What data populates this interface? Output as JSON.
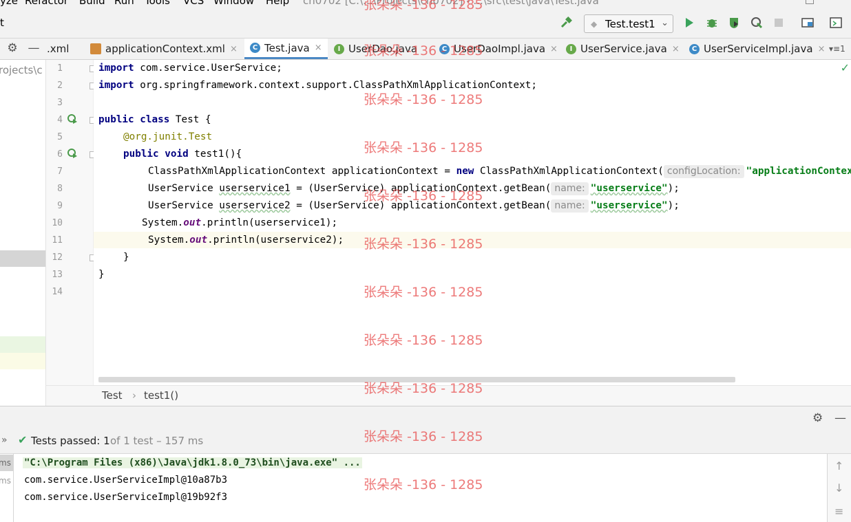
{
  "menu": {
    "items": [
      "yze",
      "Refactor",
      "Build",
      "Run",
      "Tools",
      "VCS",
      "Window",
      "Help"
    ],
    "window_title": "ch0702 [C:\\...\\Projects\\ch0702] - ...\\src\\test\\java\\Test.java"
  },
  "toolbar": {
    "crumb": "t",
    "run_config": "Test.test1",
    "icons": [
      "hammer-icon",
      "run-icon",
      "debug-icon",
      "coverage-icon",
      "profile-icon",
      "stop-icon",
      "project-structure-icon",
      "terminal-icon"
    ]
  },
  "tabs": [
    {
      "label": ".xml",
      "type": "xml"
    },
    {
      "label": "applicationContext.xml",
      "type": "xml"
    },
    {
      "label": "Test.java",
      "type": "class",
      "active": true
    },
    {
      "label": "UserDao.java",
      "type": "interface"
    },
    {
      "label": "UserDaoImpl.java",
      "type": "class"
    },
    {
      "label": "UserService.java",
      "type": "interface"
    },
    {
      "label": "UserServiceImpl.java",
      "type": "class"
    }
  ],
  "tab_overflow": "▾≡1",
  "project_panel": {
    "path_fragment": "rojects\\c"
  },
  "editor": {
    "line_numbers": [
      "1",
      "2",
      "3",
      "4",
      "5",
      "6",
      "7",
      "8",
      "9",
      "10",
      "11",
      "12",
      "13",
      "14"
    ],
    "lines": {
      "l1_kw": "import",
      "l1_rest": " com.service.UserService;",
      "l2_kw": "import",
      "l2_rest": " org.springframework.context.support.ClassPathXmlApplicationContext;",
      "l4_kw1": "public",
      "l4_kw2": "class",
      "l4_rest": " Test {",
      "l5_at": "@org.junit.",
      "l5_test": "Test",
      "l6_kw1": "public",
      "l6_kw2": "void",
      "l6_rest": " test1(){",
      "l7_a": "ClassPathXmlApplicationContext applicationContext = ",
      "l7_new": "new",
      "l7_b": " ClassPathXmlApplicationContext(",
      "l7_hint": "configLocation:",
      "l7_str": "\"applicationContext.xml\"",
      "l8_a": "UserService ",
      "l8_var": "userservice1",
      "l8_b": " = (UserService) applicationContext.getBean(",
      "l8_hint": "name:",
      "l8_str": "\"userservice\"",
      "l8_end": ");",
      "l9_a": "UserService ",
      "l9_var": "userservice2",
      "l9_b": " = (UserService) applicationContext.getBean(",
      "l9_hint": "name:",
      "l9_str": "\"userservice\"",
      "l9_end": ");",
      "l10_a": "System.",
      "l10_out": "out",
      "l10_b": ".println(userservice1);",
      "l11_a": "System.",
      "l11_out": "out",
      "l11_b": ".println(userservice2);",
      "l12": "}",
      "l13": "}"
    }
  },
  "breadcrumb": {
    "class": "Test",
    "method": "test1()"
  },
  "run_panel": {
    "status_label": "Tests passed:",
    "status_count": "1",
    "status_detail": "of 1 test – 157 ms",
    "left_list": [
      "ms",
      "ms"
    ],
    "console": [
      "\"C:\\Program Files (x86)\\Java\\jdk1.8.0_73\\bin\\java.exe\" ...",
      "com.service.UserServiceImpl@10a87b3",
      "com.service.UserServiceImpl@19b92f3"
    ]
  },
  "watermark": "张朵朵 -136 - 1285",
  "colors": {
    "keyword": "#000080",
    "string": "#067d17",
    "annotation": "#808000",
    "static_field": "#660e7a",
    "pass_green": "#3aa35c",
    "watermark": "#e64646"
  }
}
